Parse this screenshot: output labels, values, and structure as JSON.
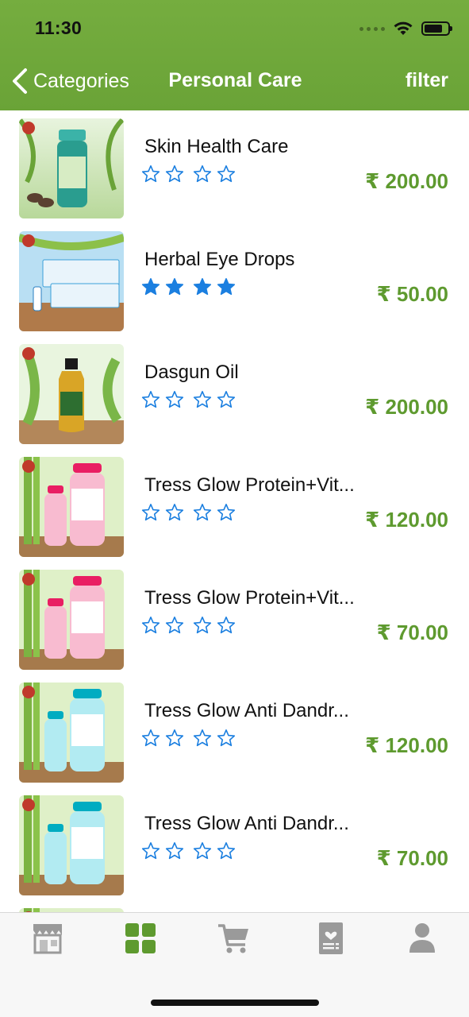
{
  "status_bar": {
    "time": "11:30"
  },
  "nav": {
    "back_label": "Categories",
    "title": "Personal Care",
    "filter_label": "filter"
  },
  "colors": {
    "header_green": "#6fa83b",
    "price_green": "#5e9a2f",
    "star_blue": "#1b7fe0",
    "tab_active": "#5e9a2f",
    "tab_inactive": "#9a9a9a"
  },
  "products": [
    {
      "name": "Skin Health Care",
      "rating": 0,
      "price": "₹ 200.00",
      "thumb": "green-jar"
    },
    {
      "name": "Herbal Eye Drops",
      "rating": 5,
      "price": "₹ 50.00",
      "thumb": "eye-drops-box"
    },
    {
      "name": "Dasgun Oil",
      "rating": 0,
      "price": "₹ 200.00",
      "thumb": "oil-bottle"
    },
    {
      "name": "Tress Glow Protein+Vit...",
      "rating": 0,
      "price": "₹ 120.00",
      "thumb": "pink-bottles"
    },
    {
      "name": "Tress Glow Protein+Vit...",
      "rating": 0,
      "price": "₹ 70.00",
      "thumb": "pink-bottles"
    },
    {
      "name": "Tress Glow Anti Dandr...",
      "rating": 0,
      "price": "₹ 120.00",
      "thumb": "blue-bottles"
    },
    {
      "name": "Tress Glow Anti Dandr...",
      "rating": 0,
      "price": "₹ 70.00",
      "thumb": "blue-bottles"
    }
  ],
  "tabs": [
    {
      "icon": "store-icon",
      "active": false
    },
    {
      "icon": "grid-icon",
      "active": true
    },
    {
      "icon": "cart-icon",
      "active": false
    },
    {
      "icon": "wishlist-icon",
      "active": false
    },
    {
      "icon": "profile-icon",
      "active": false
    }
  ]
}
